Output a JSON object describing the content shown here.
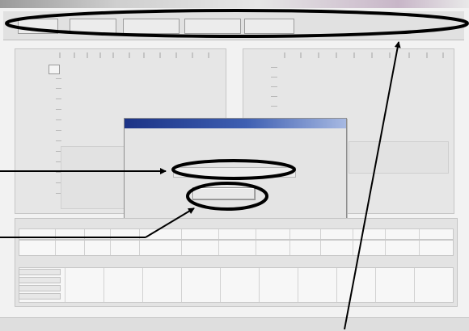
{
  "menubar": {
    "tabs": [
      {
        "label": ""
      },
      {
        "label": ""
      },
      {
        "label": ""
      },
      {
        "label": ""
      },
      {
        "label": ""
      }
    ]
  },
  "left_panel": {
    "column_headers": [
      "",
      "",
      "",
      "",
      "",
      "",
      "",
      "",
      "",
      "",
      "",
      ""
    ],
    "row_headers": [
      "",
      "",
      "",
      "",
      "",
      "",
      "",
      "",
      "",
      "",
      "",
      ""
    ],
    "selected_cell_value": ""
  },
  "right_panel": {
    "column_headers": [
      "",
      "",
      "",
      "",
      "",
      "",
      "",
      "",
      "",
      ""
    ],
    "row_headers": [
      "",
      "",
      "",
      "",
      ""
    ]
  },
  "dialog": {
    "title": "",
    "line1": "",
    "line2": "",
    "field_text": "",
    "button_label": ""
  },
  "bottom_table": {
    "title": "",
    "columns": [
      "",
      "",
      "",
      "",
      "",
      "",
      "",
      "",
      "",
      "",
      "",
      "",
      ""
    ],
    "section_title": "",
    "row_labels": [
      "",
      "",
      "",
      ""
    ]
  },
  "status_bar": {
    "text": ""
  },
  "colors": {
    "dialog_titlebar": "#1c3386",
    "annotation": "#000000"
  }
}
